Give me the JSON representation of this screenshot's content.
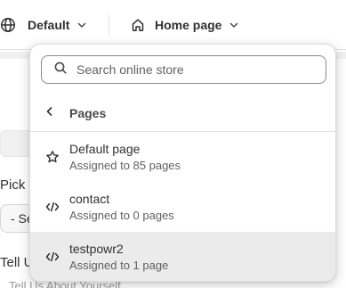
{
  "toolbar": {
    "theme_label": "Default",
    "page_label": "Home page"
  },
  "background": {
    "pick_label": "Pick",
    "select_value": "- Se",
    "tell_label": "Tell U",
    "input_hint": "Tell Us About Yourself"
  },
  "popover": {
    "search_placeholder": "Search online store",
    "back_label": "Pages",
    "items": [
      {
        "title": "Default page",
        "subtitle": "Assigned to 85 pages",
        "icon": "star-icon",
        "selected": false
      },
      {
        "title": "contact",
        "subtitle": "Assigned to 0 pages",
        "icon": "code-icon",
        "selected": false
      },
      {
        "title": "testpowr2",
        "subtitle": "Assigned to 1 page",
        "icon": "code-icon",
        "selected": true
      }
    ]
  }
}
